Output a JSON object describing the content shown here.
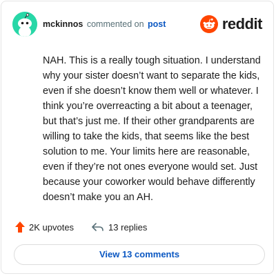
{
  "comment": {
    "username": "mckinnos",
    "action_text": "commented on",
    "post_link_text": "post",
    "body": "NAH. This is a really tough situation. I understand why your sister doesn’t want to separate the kids, even if she doesn’t know them well or whatever. I think you’re overreacting a bit about a teenager, but that’s just me. If their other grandparents are willing to take the kids, that seems like the best solution to me. Your limits here are reasonable, even if they’re not ones everyone would set. Just because your coworker would behave differently doesn’t make you an AH."
  },
  "brand": {
    "wordmark": "reddit",
    "icon": "reddit-snoo-icon",
    "color": "#ff4500"
  },
  "avatar": {
    "icon": "snoo-avatar-icon",
    "bg_color": "#28d7a7"
  },
  "footer": {
    "upvotes_label": "2K upvotes",
    "upvote_icon": "upvote-arrow-icon",
    "upvote_color": "#ff4500",
    "replies_label": "13 replies",
    "reply_icon": "reply-arrow-icon",
    "view_comments_label": "View 13 comments"
  },
  "colors": {
    "link": "#0a57c2",
    "muted": "#576f76",
    "text": "#1c1c1c"
  }
}
